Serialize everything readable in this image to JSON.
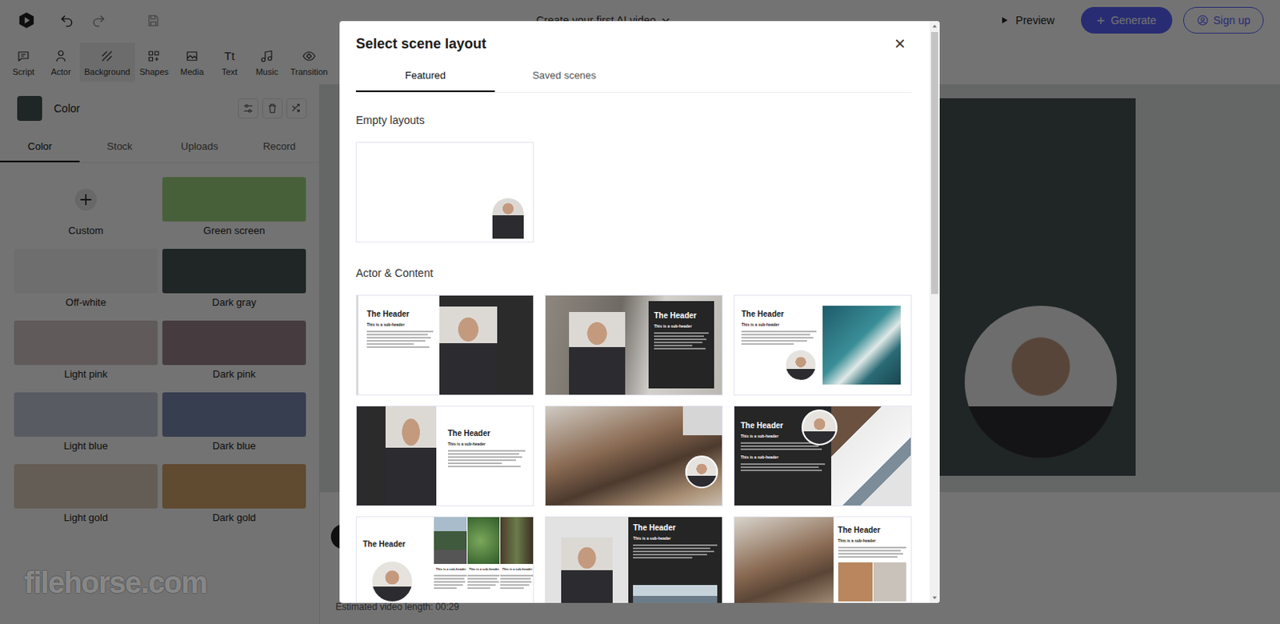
{
  "app": {
    "title": "Create your first AI video",
    "actions": {
      "preview": "Preview",
      "generate": "Generate",
      "signup": "Sign up"
    }
  },
  "toolbar": [
    {
      "label": "Script",
      "selected": false
    },
    {
      "label": "Actor",
      "selected": false
    },
    {
      "label": "Background",
      "selected": true
    },
    {
      "label": "Shapes",
      "selected": false
    },
    {
      "label": "Media",
      "selected": false
    },
    {
      "label": "Text",
      "selected": false,
      "glyph": "Tt"
    },
    {
      "label": "Music",
      "selected": false
    },
    {
      "label": "Transition",
      "selected": false
    }
  ],
  "panel": {
    "title": "Color",
    "tabs": [
      {
        "label": "Color",
        "selected": true
      },
      {
        "label": "Stock",
        "selected": false
      },
      {
        "label": "Uploads",
        "selected": false
      },
      {
        "label": "Record",
        "selected": false
      }
    ],
    "swatches": [
      {
        "label": "Custom",
        "kind": "custom"
      },
      {
        "label": "Green screen",
        "kind": "color",
        "color": "#9fd67f"
      },
      {
        "label": "Off-white",
        "kind": "color",
        "color": "#f4f4f4"
      },
      {
        "label": "Dark gray",
        "kind": "color",
        "color": "#475454"
      },
      {
        "label": "Light pink",
        "kind": "color",
        "color": "#d5c8c8"
      },
      {
        "label": "Dark pink",
        "kind": "color",
        "color": "#9b858e"
      },
      {
        "label": "Light blue",
        "kind": "color",
        "color": "#c3ccda"
      },
      {
        "label": "Dark blue",
        "kind": "color",
        "color": "#7a8ab2"
      },
      {
        "label": "Light gold",
        "kind": "color",
        "color": "#decebd"
      },
      {
        "label": "Dark gold",
        "kind": "color",
        "color": "#d4a46a"
      }
    ]
  },
  "status": {
    "estimate": "Estimated video length: 00:29"
  },
  "modal": {
    "title": "Select scene layout",
    "close": "×",
    "tabs": [
      {
        "label": "Featured",
        "selected": true
      },
      {
        "label": "Saved scenes",
        "selected": false
      }
    ],
    "sections": [
      {
        "title": "Empty layouts",
        "cards": [
          {
            "kind": "empty"
          }
        ]
      },
      {
        "title": "Actor & Content",
        "cards": [
          {
            "kind": "text-photo",
            "header": "The Header",
            "subheaders": [
              "This is a sub-header"
            ]
          },
          {
            "kind": "photo-box",
            "header": "The Header",
            "subheaders": [
              "This is a sub-header"
            ]
          },
          {
            "kind": "text-image-avatar",
            "header": "The Header",
            "subheaders": [
              "This is a sub-header"
            ]
          },
          {
            "kind": "dark-photo-text",
            "header": "The Header",
            "subheaders": [
              "This is a sub-header"
            ]
          },
          {
            "kind": "photo-avatar"
          },
          {
            "kind": "dark-text-photo-avatar",
            "header": "The Header",
            "subheaders": [
              "This is a sub-header",
              "This is a sub-header"
            ]
          },
          {
            "kind": "text-avatar-columns",
            "header": "The Header",
            "subheaders": [
              "This is a sub-header",
              "This is a sub-header",
              "This is a sub-header"
            ]
          },
          {
            "kind": "photo-dark-landscape",
            "header": "The Header",
            "subheaders": [
              "This is a sub-header"
            ]
          },
          {
            "kind": "photo-text-photos",
            "header": "The Header",
            "subheaders": [
              "This is a sub-header"
            ]
          }
        ]
      }
    ]
  },
  "watermark": "filehorse.com"
}
